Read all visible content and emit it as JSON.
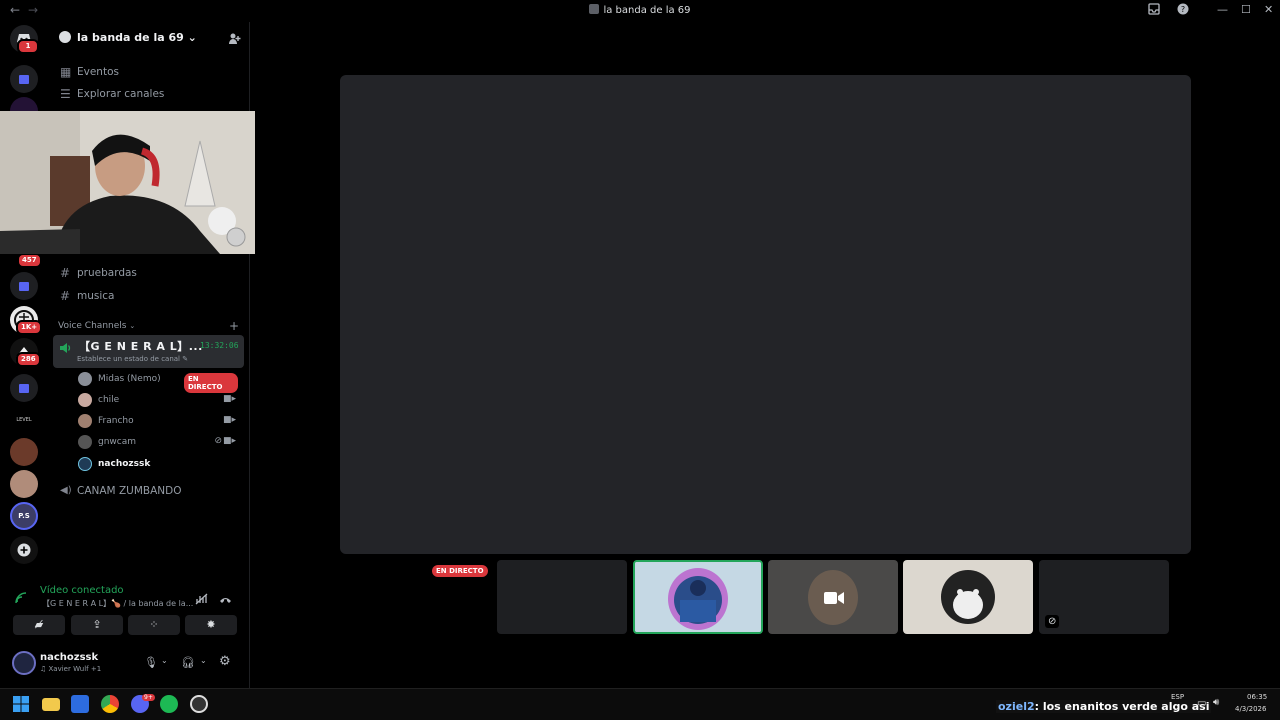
{
  "window": {
    "title": "la banda de la 69",
    "back": "←",
    "forward": "→"
  },
  "server": {
    "name": "la banda de la 69",
    "chevron": "⌄",
    "badges": {
      "home": "1",
      "b457": "457",
      "b1k": "1K+",
      "b286": "286"
    },
    "level_label": "LEVEL",
    "ps_label": "P.S"
  },
  "nav": {
    "events": "Eventos",
    "explore": "Explorar canales"
  },
  "text_channels": [
    {
      "name": "pruebardas"
    },
    {
      "name": "musica"
    }
  ],
  "voice": {
    "header": "Voice Channels",
    "active_channel": {
      "name": "【G E N E R A L】...",
      "time": "13:32:06",
      "status_placeholder": "Establece un estado de canal"
    },
    "members": [
      {
        "name": "Midas (Nemo)",
        "live": "EN DIRECTO"
      },
      {
        "name": "chile"
      },
      {
        "name": "Francho"
      },
      {
        "name": "gnwcam"
      },
      {
        "name": "nachozssk"
      }
    ],
    "other_channel": "CANAM ZUMBANDO"
  },
  "voice_panel": {
    "status": "Vídeo conectado",
    "channel": "【G E N E R A L】🍗 / la banda de la..."
  },
  "user": {
    "name": "nachozssk",
    "activity": "♫ Xavier Wulf +1"
  },
  "stage": {
    "live_badge": "EN DIRECTO"
  },
  "taskbar": {
    "stream_user": "oziel2",
    "stream_text": ": los enanitos verde algo asi",
    "lang": "ESP",
    "time": "06:35",
    "date": "4/3/2026",
    "notif_count": "9+"
  },
  "colors": {
    "accent": "#23a55a",
    "live": "#da373c",
    "blurple": "#5865f2"
  }
}
